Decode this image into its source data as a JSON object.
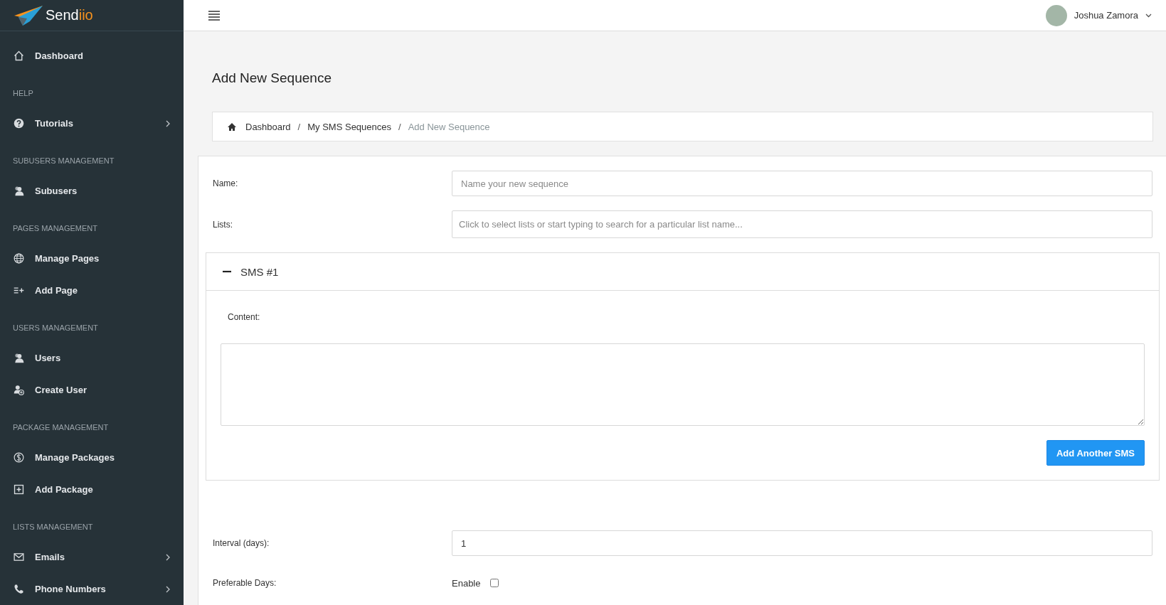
{
  "brand": {
    "name_start": "Send",
    "name_end": "iio"
  },
  "sidebar": {
    "items": [
      {
        "kind": "link",
        "label": "Dashboard",
        "has_submenu": false
      },
      {
        "kind": "section",
        "label": "HELP"
      },
      {
        "kind": "link",
        "label": "Tutorials",
        "has_submenu": true
      },
      {
        "kind": "section",
        "label": "SUBUSERS MANAGEMENT"
      },
      {
        "kind": "link",
        "label": "Subusers",
        "has_submenu": false
      },
      {
        "kind": "section",
        "label": "PAGES MANAGEMENT"
      },
      {
        "kind": "link",
        "label": "Manage Pages",
        "has_submenu": false
      },
      {
        "kind": "link",
        "label": "Add Page",
        "has_submenu": false
      },
      {
        "kind": "section",
        "label": "USERS MANAGEMENT"
      },
      {
        "kind": "link",
        "label": "Users",
        "has_submenu": false
      },
      {
        "kind": "link",
        "label": "Create User",
        "has_submenu": false
      },
      {
        "kind": "section",
        "label": "PACKAGE MANAGEMENT"
      },
      {
        "kind": "link",
        "label": "Manage Packages",
        "has_submenu": false
      },
      {
        "kind": "link",
        "label": "Add Package",
        "has_submenu": false
      },
      {
        "kind": "section",
        "label": "LISTS MANAGEMENT"
      },
      {
        "kind": "link",
        "label": "Emails",
        "has_submenu": true
      },
      {
        "kind": "link",
        "label": "Phone Numbers",
        "has_submenu": true
      }
    ]
  },
  "topbar": {
    "user_name": "Joshua Zamora"
  },
  "page": {
    "title": "Add New Sequence",
    "breadcrumb": [
      {
        "kind": "link",
        "label": "Dashboard"
      },
      {
        "kind": "separator",
        "label": "/"
      },
      {
        "kind": "link",
        "label": "My SMS Sequences"
      },
      {
        "kind": "separator",
        "label": "/"
      },
      {
        "kind": "current",
        "label": "Add New Sequence"
      }
    ],
    "name_field": {
      "label": "Name:",
      "placeholder": "Name your new sequence"
    },
    "lists_field": {
      "label": "Lists:",
      "placeholder": "Click to select lists or start typing to search for a particular list name..."
    },
    "sms_panel": {
      "title": "SMS #1",
      "expanded": true,
      "content_label": "Content:",
      "button": "Add Another SMS"
    },
    "interval_field": {
      "label": "Interval (days):",
      "value": "1"
    },
    "preferable_days": {
      "label": "Preferable Days:",
      "option": "Enable",
      "checked": false
    }
  }
}
